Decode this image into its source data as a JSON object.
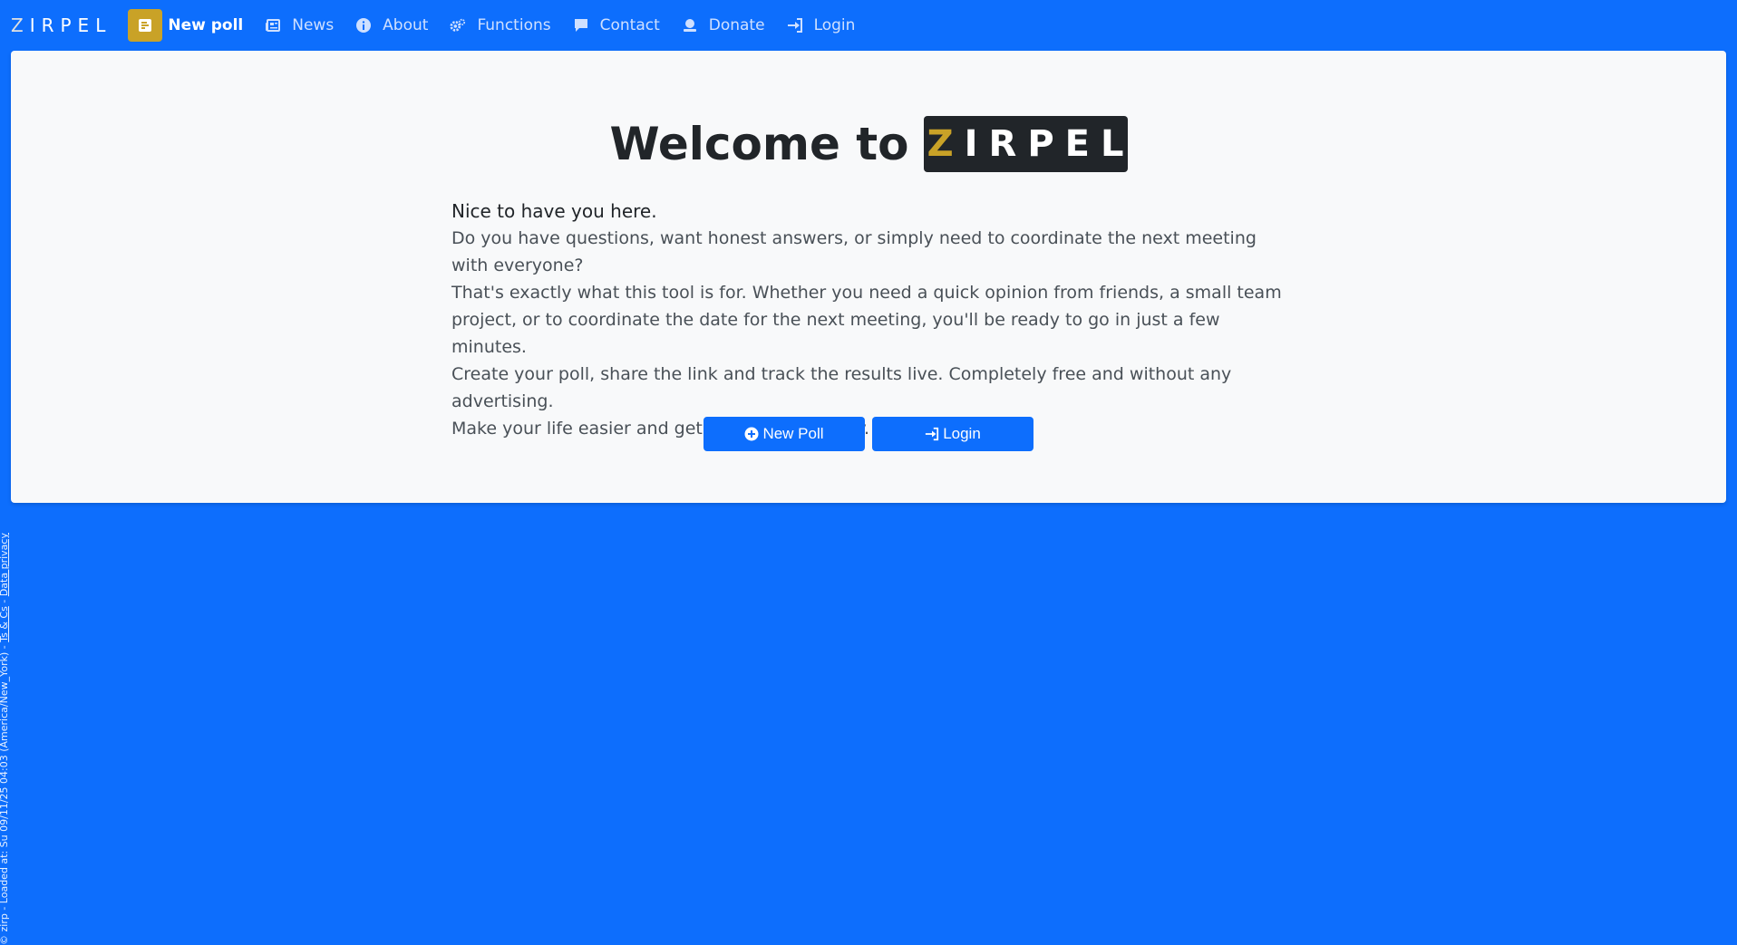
{
  "nav": {
    "brand": {
      "first": "Z",
      "rest": "IRPEL"
    },
    "items": [
      {
        "label": "New poll",
        "icon": "poll-icon"
      },
      {
        "label": "News",
        "icon": "newspaper-icon"
      },
      {
        "label": "About",
        "icon": "info-icon"
      },
      {
        "label": "Functions",
        "icon": "gears-icon"
      },
      {
        "label": "Contact",
        "icon": "comment-icon"
      },
      {
        "label": "Donate",
        "icon": "donate-icon"
      },
      {
        "label": "Login",
        "icon": "login-icon"
      }
    ]
  },
  "hero": {
    "title": "Welcome to",
    "logo": {
      "first": "Z",
      "rest": "IRPEL"
    }
  },
  "intro": {
    "lead": "Nice to have you here.",
    "line1": "Do you have questions, want honest answers, or simply need to coordinate the next meeting with everyone?",
    "line2": "That's exactly what this tool is for. Whether you need a quick opinion from friends, a small team project, or to coordinate the date for the next meeting, you'll be ready to go in just a few minutes.",
    "line3": "Create your poll, share the link and track the results live. Completely free and without any advertising.",
    "line4": "Make your life easier and get started right away."
  },
  "actions": {
    "new_poll": "New Poll",
    "login": "Login"
  },
  "footer": {
    "prefix": "© zirp - Loaded at: Su 09/11/25 04:03 (America/New_York) - ",
    "terms": "Ts & Cs",
    "separator": " - ",
    "privacy": "Data privacy"
  },
  "colors": {
    "primary": "#0d6efd",
    "accent_gold": "#c9a227",
    "dark": "#212529",
    "card_bg": "#f8f9fa"
  }
}
